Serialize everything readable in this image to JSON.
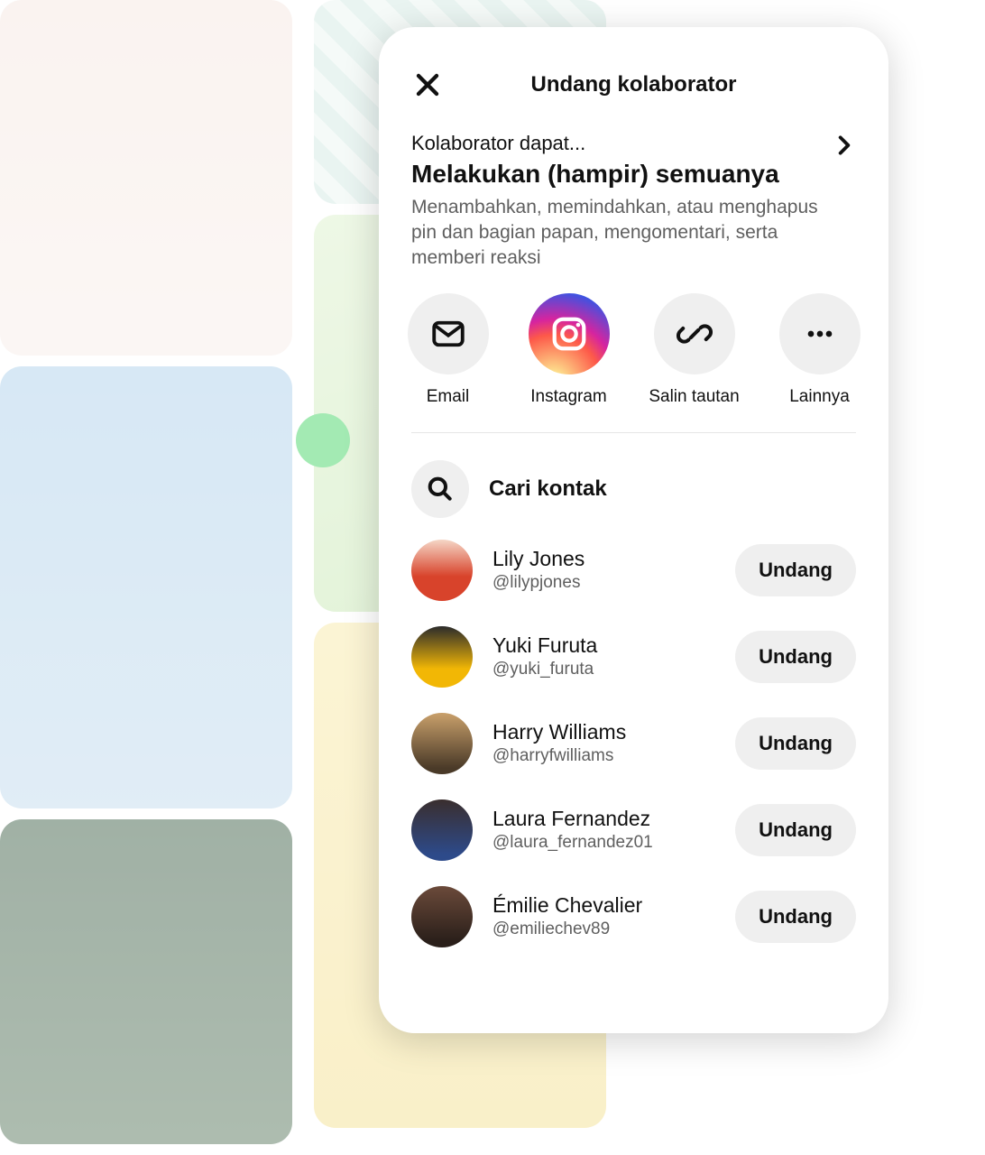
{
  "modal": {
    "title": "Undang kolaborator",
    "permission": {
      "label": "Kolaborator dapat...",
      "title": "Melakukan (hampir) semuanya",
      "description": "Menambahkan, memindahkan, atau menghapus pin dan bagian papan, mengomentari, serta memberi reaksi"
    },
    "share": {
      "email": "Email",
      "instagram": "Instagram",
      "copy_link": "Salin tautan",
      "more": "Lainnya"
    },
    "search_placeholder": "Cari kontak",
    "invite_label": "Undang",
    "contacts": [
      {
        "name": "Lily Jones",
        "handle": "@lilypjones"
      },
      {
        "name": "Yuki Furuta",
        "handle": "@yuki_furuta"
      },
      {
        "name": "Harry Williams",
        "handle": "@harryfwilliams"
      },
      {
        "name": "Laura Fernandez",
        "handle": "@laura_fernandez01"
      },
      {
        "name": "Émilie Chevalier",
        "handle": "@emiliechev89"
      }
    ]
  }
}
